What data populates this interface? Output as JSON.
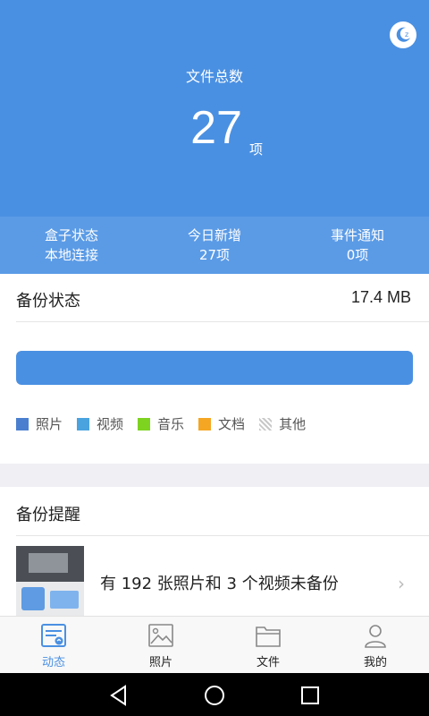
{
  "hero": {
    "title": "文件总数",
    "count": "27",
    "unit": "项",
    "sleep_icon": "moon-sleep-icon"
  },
  "stats": [
    {
      "label": "盒子状态",
      "value": "本地连接"
    },
    {
      "label": "今日新增",
      "value": "27项"
    },
    {
      "label": "事件通知",
      "value": "0项"
    }
  ],
  "backup": {
    "title": "备份状态",
    "size": "17.4 MB",
    "progress_fraction": 1.0,
    "legend": [
      {
        "label": "照片",
        "color": "#4a7fd0"
      },
      {
        "label": "视频",
        "color": "#4aa3df"
      },
      {
        "label": "音乐",
        "color": "#7ed321"
      },
      {
        "label": "文档",
        "color": "#f5a623"
      },
      {
        "label": "其他",
        "color": "striped"
      }
    ]
  },
  "remind": {
    "title": "备份提醒",
    "message": "有 192 张照片和  3 个视频未备份"
  },
  "tabs": [
    {
      "label": "动态",
      "icon": "activity-icon",
      "active": true
    },
    {
      "label": "照片",
      "icon": "photo-icon",
      "active": false
    },
    {
      "label": "文件",
      "icon": "folder-icon",
      "active": false
    },
    {
      "label": "我的",
      "icon": "user-icon",
      "active": false
    }
  ],
  "colors": {
    "primary": "#4a90e2",
    "stats_bg": "#5b9be6"
  }
}
